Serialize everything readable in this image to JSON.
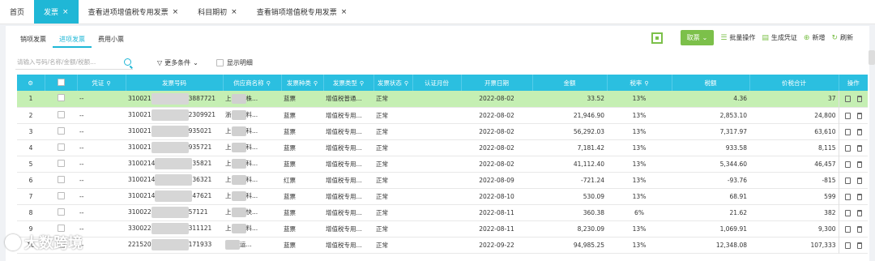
{
  "tabs": [
    {
      "label": "首页",
      "closable": false,
      "active": false
    },
    {
      "label": "发票",
      "closable": true,
      "active": true
    },
    {
      "label": "查看进项增值税专用发票",
      "closable": true,
      "active": false
    },
    {
      "label": "科目期初",
      "closable": true,
      "active": false
    },
    {
      "label": "查看销项增值税专用发票",
      "closable": true,
      "active": false
    }
  ],
  "close_glyph": "×",
  "subtabs": [
    {
      "label": "销项发票",
      "active": false
    },
    {
      "label": "进项发票",
      "active": true
    },
    {
      "label": "费用小票",
      "active": false
    }
  ],
  "toolbar": {
    "fetch_label": "取票",
    "batch_label": "批量操作",
    "voucher_label": "生成凭证",
    "new_label": "新增",
    "refresh_label": "刷新"
  },
  "filters": {
    "search_placeholder": "请输入号码/名称/金额/税额...",
    "more_label": "更多条件",
    "show_detail_label": "显示明细"
  },
  "columns": [
    "",
    "",
    "凭证",
    "发票号码",
    "供应商名称",
    "发票种类",
    "发票类型",
    "发票状态",
    "认证月份",
    "开票日期",
    "金额",
    "税率",
    "税额",
    "价税合计",
    "操作"
  ],
  "rows": [
    {
      "idx": "1",
      "voucher": "--",
      "no_a": "310021",
      "no_b": "3887721",
      "supplier_a": "上",
      "supplier_b": "株...",
      "kind": "蓝票",
      "type": "增值税普通...",
      "status": "正常",
      "cert": "",
      "date": "2022-08-02",
      "amount": "33.52",
      "rate": "13%",
      "tax": "4.36",
      "total": "37"
    },
    {
      "idx": "2",
      "voucher": "--",
      "no_a": "310021",
      "no_b": "2309921",
      "supplier_a": "浙",
      "supplier_b": "料...",
      "kind": "蓝票",
      "type": "增值税专用...",
      "status": "正常",
      "cert": "",
      "date": "2022-08-02",
      "amount": "21,946.90",
      "rate": "13%",
      "tax": "2,853.10",
      "total": "24,800"
    },
    {
      "idx": "3",
      "voucher": "--",
      "no_a": "310021",
      "no_b": "935021",
      "supplier_a": "上",
      "supplier_b": "科...",
      "kind": "蓝票",
      "type": "增值税专用...",
      "status": "正常",
      "cert": "",
      "date": "2022-08-02",
      "amount": "56,292.03",
      "rate": "13%",
      "tax": "7,317.97",
      "total": "63,610"
    },
    {
      "idx": "4",
      "voucher": "--",
      "no_a": "310021",
      "no_b": "935721",
      "supplier_a": "上",
      "supplier_b": "科...",
      "kind": "蓝票",
      "type": "增值税专用...",
      "status": "正常",
      "cert": "",
      "date": "2022-08-02",
      "amount": "7,181.42",
      "rate": "13%",
      "tax": "933.58",
      "total": "8,115"
    },
    {
      "idx": "5",
      "voucher": "--",
      "no_a": "3100214",
      "no_b": "35821",
      "supplier_a": "上",
      "supplier_b": "科...",
      "kind": "蓝票",
      "type": "增值税专用...",
      "status": "正常",
      "cert": "",
      "date": "2022-08-02",
      "amount": "41,112.40",
      "rate": "13%",
      "tax": "5,344.60",
      "total": "46,457"
    },
    {
      "idx": "6",
      "voucher": "--",
      "no_a": "3100214",
      "no_b": "36321",
      "supplier_a": "上",
      "supplier_b": "科...",
      "kind": "红票",
      "type": "增值税专用...",
      "status": "正常",
      "cert": "",
      "date": "2022-08-09",
      "amount": "-721.24",
      "rate": "13%",
      "tax": "-93.76",
      "total": "-815"
    },
    {
      "idx": "7",
      "voucher": "--",
      "no_a": "3100214",
      "no_b": "47621",
      "supplier_a": "上",
      "supplier_b": "科...",
      "kind": "蓝票",
      "type": "增值税专用...",
      "status": "正常",
      "cert": "",
      "date": "2022-08-10",
      "amount": "530.09",
      "rate": "13%",
      "tax": "68.91",
      "total": "599"
    },
    {
      "idx": "8",
      "voucher": "--",
      "no_a": "310022",
      "no_b": "57121",
      "supplier_a": "上",
      "supplier_b": "快...",
      "kind": "蓝票",
      "type": "增值税专用...",
      "status": "正常",
      "cert": "",
      "date": "2022-08-11",
      "amount": "360.38",
      "rate": "6%",
      "tax": "21.62",
      "total": "382"
    },
    {
      "idx": "9",
      "voucher": "--",
      "no_a": "330022",
      "no_b": "311121",
      "supplier_a": "上",
      "supplier_b": "料...",
      "kind": "蓝票",
      "type": "增值税专用...",
      "status": "正常",
      "cert": "",
      "date": "2022-08-11",
      "amount": "8,230.09",
      "rate": "13%",
      "tax": "1,069.91",
      "total": "9,300"
    },
    {
      "idx": "10",
      "voucher": "--",
      "no_a": "221520",
      "no_b": "171933",
      "supplier_a": "",
      "supplier_b": "运...",
      "kind": "蓝票",
      "type": "增值税专用...",
      "status": "正常",
      "cert": "",
      "date": "2022-09-22",
      "amount": "94,985.25",
      "rate": "13%",
      "tax": "12,348.08",
      "total": "107,333"
    }
  ],
  "watermark": "大数跨境"
}
